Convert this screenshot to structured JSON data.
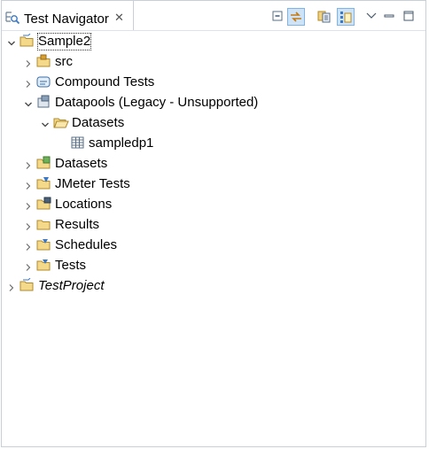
{
  "view": {
    "title": "Test Navigator",
    "close_glyph": "✕",
    "toolbar": [
      {
        "name": "collapse-all-icon"
      },
      {
        "name": "link-with-editor-icon",
        "pressed": true
      },
      {
        "name": "show-resources-icon"
      },
      {
        "name": "show-logical-icon",
        "pressed": true
      },
      {
        "name": "view-menu-icon"
      },
      {
        "name": "minimize-icon"
      },
      {
        "name": "maximize-icon"
      }
    ]
  },
  "tree": [
    {
      "label": "Sample2",
      "level": 0,
      "state": "expanded",
      "icon": "project-folder-icon",
      "selected": true
    },
    {
      "label": "src",
      "level": 1,
      "state": "collapsed",
      "icon": "source-folder-icon"
    },
    {
      "label": "Compound Tests",
      "level": 1,
      "state": "collapsed",
      "icon": "compound-tests-icon"
    },
    {
      "label": "Datapools (Legacy - Unsupported)",
      "level": 1,
      "state": "expanded",
      "icon": "datapools-icon"
    },
    {
      "label": "Datasets",
      "level": 2,
      "state": "expanded",
      "icon": "folder-open-icon"
    },
    {
      "label": "sampledp1",
      "level": 3,
      "state": "leaf",
      "icon": "datapool-table-icon"
    },
    {
      "label": "Datasets",
      "level": 1,
      "state": "collapsed",
      "icon": "datasets-icon"
    },
    {
      "label": "JMeter Tests",
      "level": 1,
      "state": "collapsed",
      "icon": "jmeter-folder-icon"
    },
    {
      "label": "Locations",
      "level": 1,
      "state": "collapsed",
      "icon": "locations-icon"
    },
    {
      "label": "Results",
      "level": 1,
      "state": "collapsed",
      "icon": "results-folder-icon"
    },
    {
      "label": "Schedules",
      "level": 1,
      "state": "collapsed",
      "icon": "schedules-folder-icon"
    },
    {
      "label": "Tests",
      "level": 1,
      "state": "collapsed",
      "icon": "tests-folder-icon"
    },
    {
      "label": "TestProject",
      "level": 0,
      "state": "collapsed",
      "icon": "project-folder-icon",
      "italic": true
    }
  ]
}
